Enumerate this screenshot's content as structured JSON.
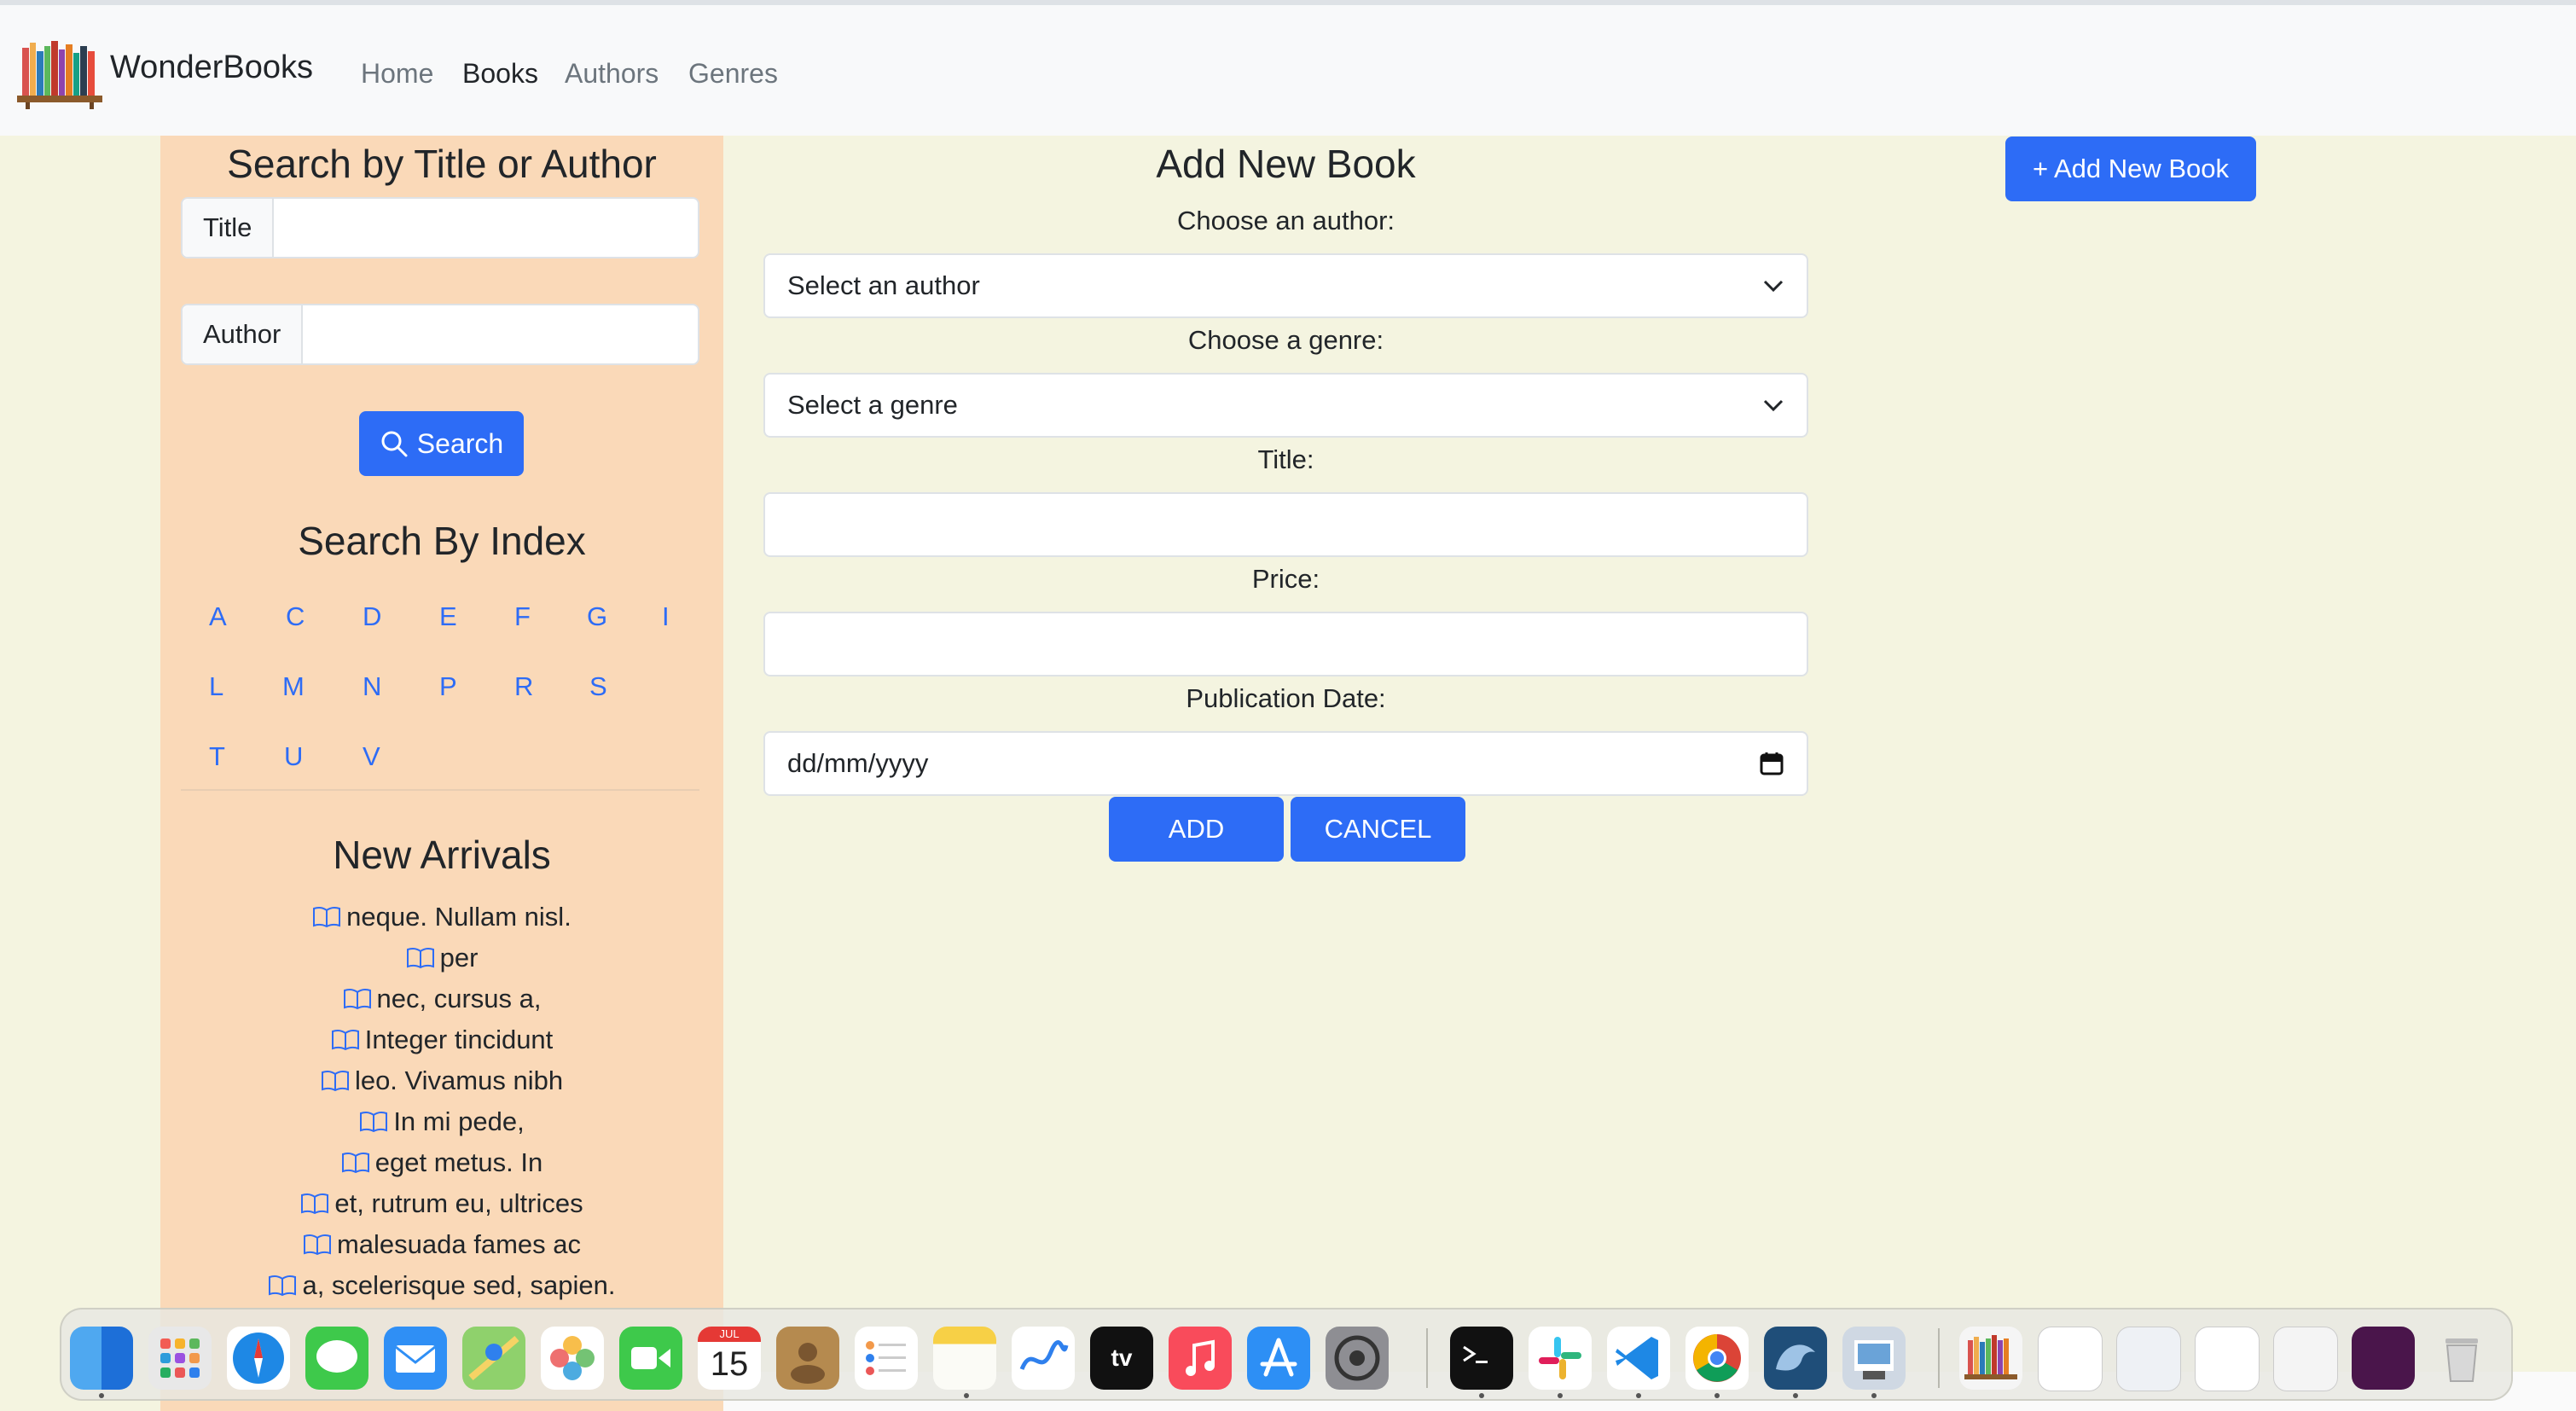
{
  "nav": {
    "brand": "WonderBooks",
    "links": [
      "Home",
      "Books",
      "Authors",
      "Genres"
    ],
    "active": "Books"
  },
  "sidebar": {
    "search_heading": "Search by Title or Author",
    "title_label": "Title",
    "title_value": "",
    "author_label": "Author",
    "author_value": "",
    "search_button": "Search",
    "index_heading": "Search By Index",
    "index_letters": [
      "A",
      "C",
      "D",
      "E",
      "F",
      "G",
      "I",
      "L",
      "M",
      "N",
      "P",
      "R",
      "S",
      "T",
      "U",
      "V"
    ],
    "arrivals_heading": "New Arrivals",
    "arrivals": [
      "neque. Nullam nisl.",
      "per",
      "nec, cursus a,",
      "Integer tincidunt",
      "leo. Vivamus nibh",
      "In mi pede,",
      "eget metus. In",
      "et, rutrum eu, ultrices",
      "malesuada fames ac",
      "a, scelerisque sed, sapien."
    ]
  },
  "form": {
    "heading": "Add New Book",
    "author_label": "Choose an author:",
    "author_placeholder": "Select an author",
    "genre_label": "Choose a genre:",
    "genre_placeholder": "Select a genre",
    "title_label": "Title:",
    "title_value": "",
    "price_label": "Price:",
    "price_value": "",
    "date_label": "Publication Date:",
    "date_placeholder": "dd/mm/yyyy",
    "add_button": "ADD",
    "cancel_button": "CANCEL"
  },
  "add_new_button": "+ Add New Book",
  "dock": {
    "apps": [
      "finder-icon",
      "launchpad-icon",
      "safari-icon",
      "messages-icon",
      "mail-icon",
      "maps-icon",
      "photos-icon",
      "facetime-icon",
      "calendar-icon",
      "contacts-icon",
      "reminders-icon",
      "notes-icon",
      "freeform-icon",
      "appletv-icon",
      "music-icon",
      "appstore-icon",
      "system-settings-icon",
      "terminal-icon",
      "slack-icon",
      "vscode-icon",
      "chrome-icon",
      "mysql-workbench-icon",
      "preview-icon"
    ],
    "calendar_month": "JUL",
    "calendar_day": "15",
    "tv_label": "tv",
    "recent": [
      "recent-bookshelf-icon",
      "recent-doc-1-icon",
      "recent-doc-2-icon",
      "recent-doc-3-icon",
      "recent-doc-4-icon",
      "recent-doc-5-icon"
    ],
    "trash": "trash-icon"
  },
  "colors": {
    "accent": "#2d6cf6",
    "sidebar_bg": "#fad9b8",
    "page_bg": "#f4f4e0",
    "navbar_bg": "#f8f9fa"
  }
}
